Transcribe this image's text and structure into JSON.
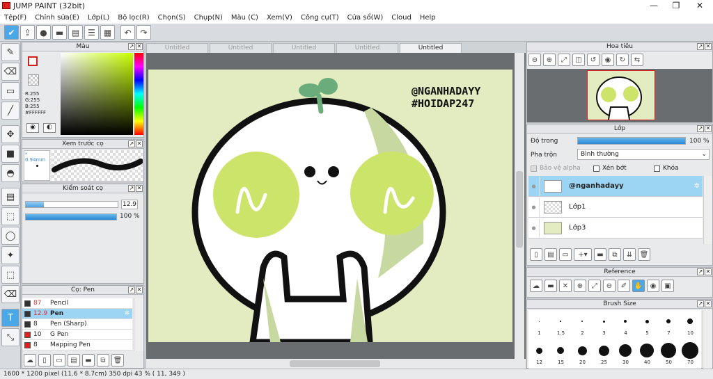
{
  "app": {
    "title": "JUMP PAINT (32bit)",
    "window_controls": [
      "—",
      "❐",
      "✕"
    ]
  },
  "menu": [
    "Tệp(F)",
    "Chỉnh sửa(E)",
    "Lớp(L)",
    "Bộ lọc(R)",
    "Chọn(S)",
    "Chụp(N)",
    "Màu (C)",
    "Xem(V)",
    "Công cụ(T)",
    "Cửa sổ(W)",
    "Cloud",
    "Help"
  ],
  "toolbar": {
    "icons": [
      "check-icon",
      "export-icon",
      "speech-bubble-icon",
      "comment-icon",
      "page-icon",
      "page-list-icon",
      "grid-check-icon"
    ],
    "undo": "↶",
    "redo": "↷"
  },
  "tools": [
    {
      "name": "pen-tool-icon",
      "glyph": "✎"
    },
    {
      "name": "eraser-tool-icon",
      "glyph": "⌫"
    },
    {
      "name": "rectangle-tool-icon",
      "glyph": "▭"
    },
    {
      "name": "line-tool-icon",
      "glyph": "╱"
    },
    {
      "name": "move-tool-icon",
      "glyph": "✥"
    },
    {
      "name": "fill-rect-tool-icon",
      "glyph": "■"
    },
    {
      "name": "bucket-tool-icon",
      "glyph": "◓"
    },
    {
      "name": "gradient-tool-icon",
      "glyph": "▤"
    },
    {
      "name": "select-rect-tool-icon",
      "glyph": "⬚"
    },
    {
      "name": "lasso-tool-icon",
      "glyph": "◯"
    },
    {
      "name": "magic-wand-tool-icon",
      "glyph": "✦"
    },
    {
      "name": "select-pen-tool-icon",
      "glyph": "⬚"
    },
    {
      "name": "select-eraser-tool-icon",
      "glyph": "⌫"
    },
    {
      "name": "text-tool-icon",
      "glyph": "T"
    },
    {
      "name": "object-select-tool-icon",
      "glyph": "⤡"
    }
  ],
  "color_panel": {
    "title": "Màu",
    "r": "R:255",
    "g": "G:255",
    "b": "B:255",
    "hex": "#FFFFFF"
  },
  "preview_panel": {
    "title": "Xem trước cọ",
    "size": "* 0.94mm"
  },
  "brush_control": {
    "title": "Kiểm soát cọ",
    "size": "12.9",
    "opacity": "100 %",
    "size_fraction": 0.2,
    "opacity_fraction": 1.0
  },
  "brush_list": {
    "title": "Cọ: Pen",
    "items": [
      {
        "size": "87",
        "name": "Pencil",
        "color": "#333333",
        "size_color": "#e03030"
      },
      {
        "size": "12.9",
        "name": "Pen",
        "color": "#333333",
        "size_color": "#e03030",
        "selected": true
      },
      {
        "size": "8",
        "name": "Pen (Sharp)",
        "color": "#333333"
      },
      {
        "size": "10",
        "name": "G Pen",
        "color": "#e02020"
      },
      {
        "size": "8",
        "name": "Mapping Pen",
        "color": "#e02020"
      }
    ]
  },
  "doc_tabs": [
    {
      "label": "Untitled"
    },
    {
      "label": "Untitled"
    },
    {
      "label": "Untitled"
    },
    {
      "label": "Untitled"
    },
    {
      "label": "Untitled",
      "active": true
    }
  ],
  "canvas": {
    "watermark_line1": "@NGANHADAYY",
    "watermark_line2": "#HOIDAP247",
    "bg": "#e2ecc0",
    "accent": "#cde46a",
    "sprout": "#6aac7a"
  },
  "navigator": {
    "title": "Hoa tiêu"
  },
  "layer_panel": {
    "title": "Lớp",
    "opacity_label": "Độ trong",
    "opacity_value": "100 %",
    "blend_label": "Pha trộn",
    "blend_value": "Bình thường",
    "protect_alpha": "Bảo vệ alpha",
    "clipping": "Xén bớt",
    "lock": "Khóa",
    "layers": [
      {
        "name": "@nganhadayy",
        "selected": true
      },
      {
        "name": "Lớp1"
      },
      {
        "name": "Lớp3"
      }
    ]
  },
  "reference_panel": {
    "title": "Reference"
  },
  "brush_size_panel": {
    "title": "Brush Size",
    "sizes": [
      "1",
      "1.5",
      "2",
      "3",
      "4",
      "5",
      "7",
      "10",
      "12",
      "15",
      "20",
      "25",
      "30",
      "40",
      "50",
      "70"
    ]
  },
  "status": {
    "text": "1600 * 1200 pixel  (11.6 * 8.7cm)  350 dpi  43 %  ( 11, 349 )"
  }
}
